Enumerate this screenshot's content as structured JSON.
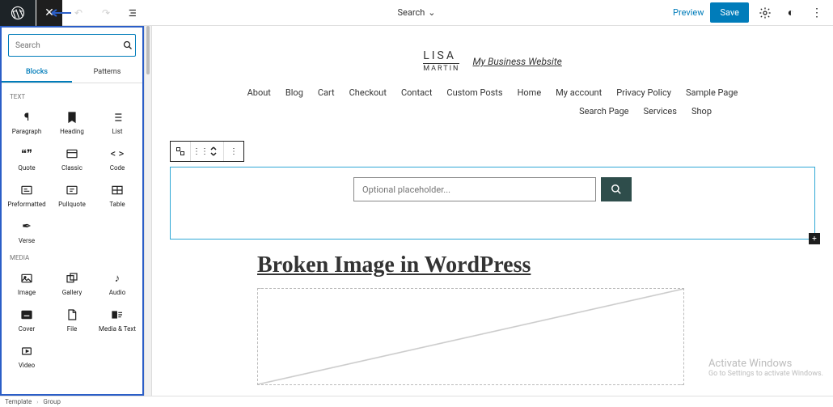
{
  "topbar": {
    "document_title": "Search",
    "preview": "Preview",
    "save": "Save"
  },
  "inserter": {
    "search_placeholder": "Search",
    "tabs": {
      "blocks": "Blocks",
      "patterns": "Patterns"
    },
    "cat_text": "TEXT",
    "cat_media": "MEDIA",
    "text_blocks": [
      {
        "icon": "¶",
        "label": "Paragraph"
      },
      {
        "icon": "bookmark",
        "label": "Heading"
      },
      {
        "icon": "list",
        "label": "List"
      },
      {
        "icon": "❝❞",
        "label": "Quote"
      },
      {
        "icon": "classic",
        "label": "Classic"
      },
      {
        "icon": "< >",
        "label": "Code"
      },
      {
        "icon": "pre",
        "label": "Preformatted"
      },
      {
        "icon": "pull",
        "label": "Pullquote"
      },
      {
        "icon": "table",
        "label": "Table"
      },
      {
        "icon": "feather",
        "label": "Verse"
      }
    ],
    "media_blocks": [
      {
        "icon": "image",
        "label": "Image"
      },
      {
        "icon": "gallery",
        "label": "Gallery"
      },
      {
        "icon": "♪",
        "label": "Audio"
      },
      {
        "icon": "cover",
        "label": "Cover"
      },
      {
        "icon": "file",
        "label": "File"
      },
      {
        "icon": "mediatext",
        "label": "Media & Text"
      },
      {
        "icon": "video",
        "label": "Video"
      }
    ]
  },
  "site": {
    "logo_l1": "LISA",
    "logo_l2": "MARTIN",
    "title": "My Business Website",
    "nav1": [
      "About",
      "Blog",
      "Cart",
      "Checkout",
      "Contact",
      "Custom Posts",
      "Home",
      "My account",
      "Privacy Policy",
      "Sample Page"
    ],
    "nav2": [
      "Search Page",
      "Services",
      "Shop"
    ]
  },
  "search_block": {
    "placeholder": "Optional placeholder..."
  },
  "post": {
    "title": "Broken Image in WordPress"
  },
  "watermark": {
    "l1": "Activate Windows",
    "l2": "Go to Settings to activate Windows."
  },
  "breadcrumb": {
    "a": "Template",
    "b": "Group"
  }
}
